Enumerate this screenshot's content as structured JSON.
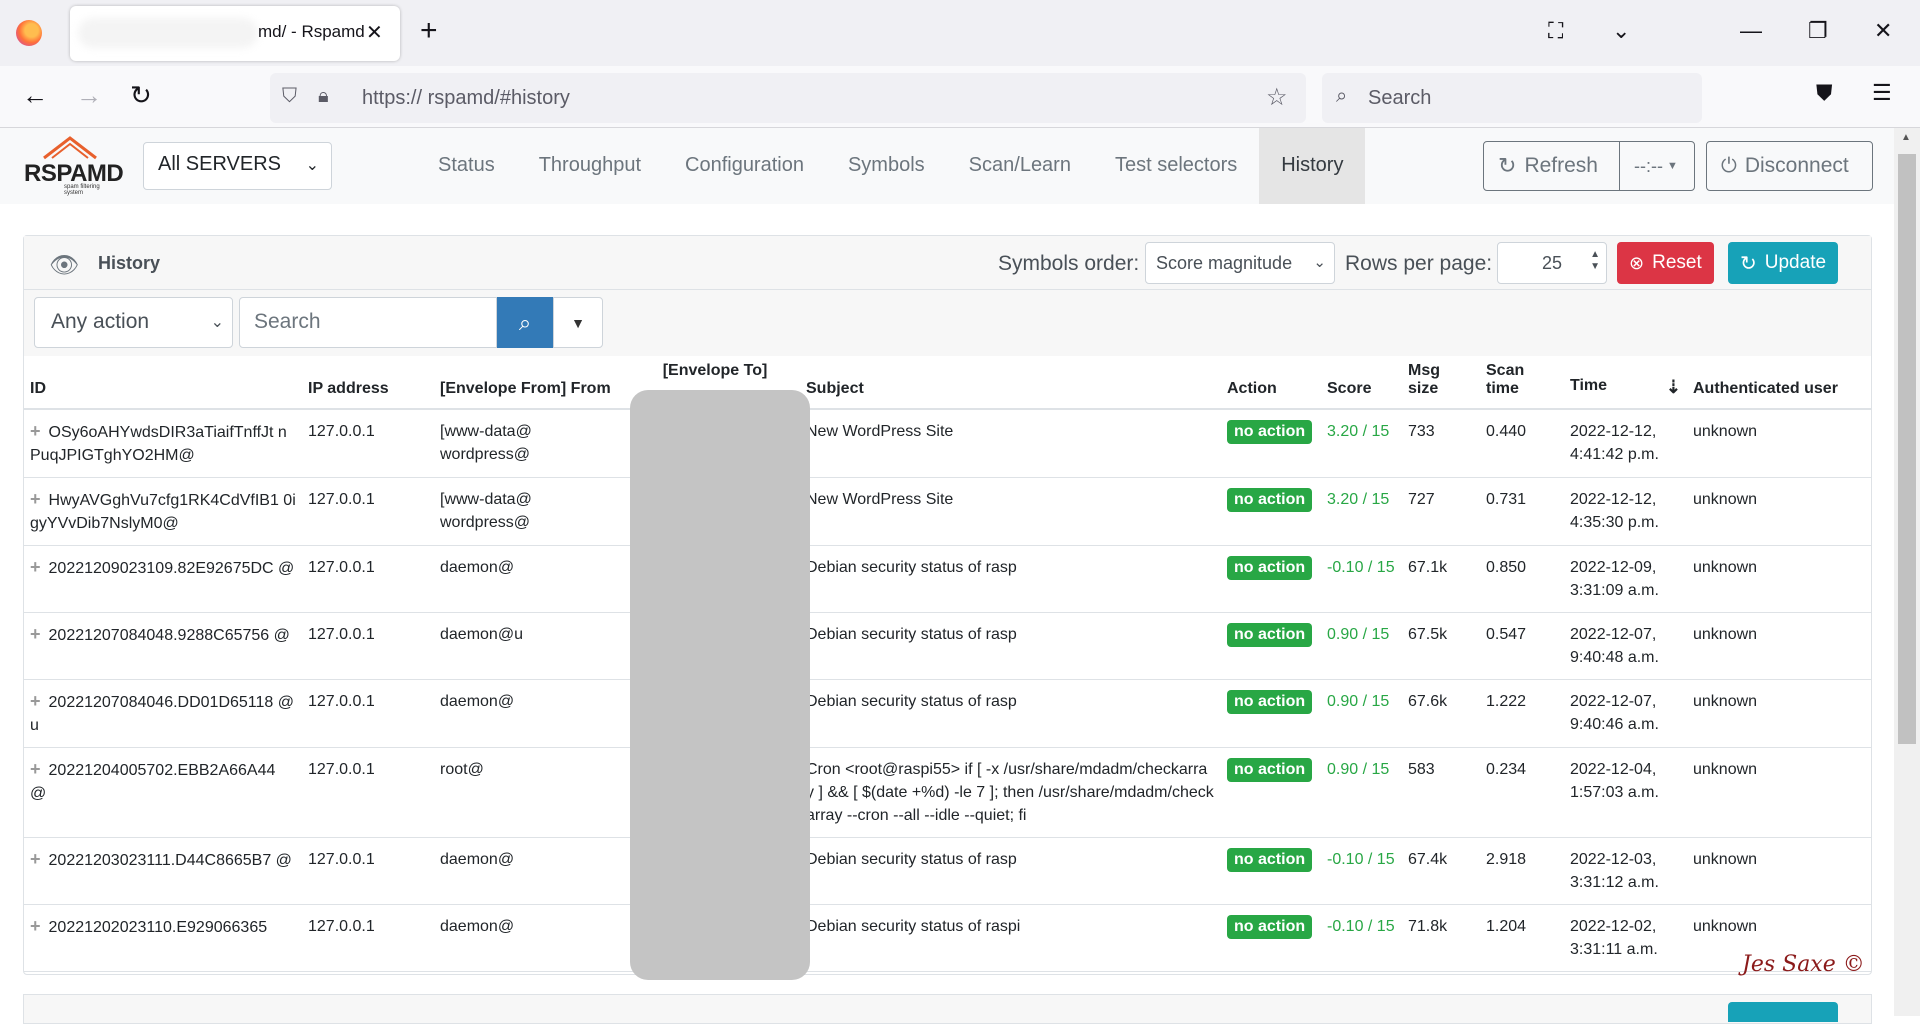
{
  "browser": {
    "tab_title": "md/ - Rspamd",
    "url": "https:// rspamd/#history",
    "search_placeholder": "Search"
  },
  "app": {
    "logo_text": "RSPAMD",
    "logo_sub": "spam filtering system",
    "server_select": "All SERVERS",
    "nav": [
      "Status",
      "Throughput",
      "Configuration",
      "Symbols",
      "Scan/Learn",
      "Test selectors",
      "History"
    ],
    "active_nav": "History",
    "refresh_label": "Refresh",
    "interval_label": "--:--",
    "disconnect_label": "Disconnect"
  },
  "history": {
    "title": "History",
    "symbols_order_label": "Symbols order:",
    "symbols_order_value": "Score magnitude",
    "rows_per_page_label": "Rows per page:",
    "rows_per_page_value": "25",
    "reset_label": "Reset",
    "update_label": "Update",
    "action_filter": "Any action",
    "search_placeholder": "Search",
    "columns": [
      "ID",
      "IP address",
      "[Envelope From] From",
      "[Envelope To]",
      "Subject",
      "Action",
      "Score",
      "Msg size",
      "Scan time",
      "Time",
      "Authenticated user"
    ],
    "rows": [
      {
        "id": "OSy6oAHYwdsDIR3aTiaifTnffJt nPuqJPIGTghYO2HM@",
        "ip": "127.0.0.1",
        "from": "[www-data@ wordpress@",
        "subject": "New WordPress Site",
        "action": "no action",
        "score": "3.20 / 15",
        "size": "733",
        "scan": "0.440",
        "time": "2022-12-12, 4:41:42 p.m.",
        "user": "unknown"
      },
      {
        "id": "HwyAVGghVu7cfg1RK4CdVfIB1 0igyYVvDib7NslyM0@",
        "ip": "127.0.0.1",
        "from": "[www-data@ wordpress@",
        "subject": "New WordPress Site",
        "action": "no action",
        "score": "3.20 / 15",
        "size": "727",
        "scan": "0.731",
        "time": "2022-12-12, 4:35:30 p.m.",
        "user": "unknown"
      },
      {
        "id": "20221209023109.82E92675DC @",
        "ip": "127.0.0.1",
        "from": "daemon@",
        "subject": "Debian security status of rasp",
        "action": "no action",
        "score": "-0.10 / 15",
        "size": "67.1k",
        "scan": "0.850",
        "time": "2022-12-09, 3:31:09 a.m.",
        "user": "unknown"
      },
      {
        "id": "20221207084048.9288C65756 @",
        "ip": "127.0.0.1",
        "from": "daemon@u",
        "subject": "Debian security status of rasp",
        "action": "no action",
        "score": "0.90 / 15",
        "size": "67.5k",
        "scan": "0.547",
        "time": "2022-12-07, 9:40:48 a.m.",
        "user": "unknown"
      },
      {
        "id": "20221207084046.DD01D65118 @u",
        "ip": "127.0.0.1",
        "from": "daemon@",
        "subject": "Debian security status of rasp",
        "action": "no action",
        "score": "0.90 / 15",
        "size": "67.6k",
        "scan": "1.222",
        "time": "2022-12-07, 9:40:46 a.m.",
        "user": "unknown"
      },
      {
        "id": "20221204005702.EBB2A66A44 @",
        "ip": "127.0.0.1",
        "from": "root@",
        "subject": "Cron <root@raspi55> if [ -x /usr/share/mdadm/checkarray ] && [ $(date +%d) -le 7 ]; then /usr/share/mdadm/checkarray --cron --all --idle --quiet; fi",
        "action": "no action",
        "score": "0.90 / 15",
        "size": "583",
        "scan": "0.234",
        "time": "2022-12-04, 1:57:03 a.m.",
        "user": "unknown"
      },
      {
        "id": "20221203023111.D44C8665B7 @",
        "ip": "127.0.0.1",
        "from": "daemon@",
        "subject": "Debian security status of rasp",
        "action": "no action",
        "score": "-0.10 / 15",
        "size": "67.4k",
        "scan": "2.918",
        "time": "2022-12-03, 3:31:12 a.m.",
        "user": "unknown"
      },
      {
        "id": "20221202023110.E929066365",
        "ip": "127.0.0.1",
        "from": "daemon@",
        "subject": "Debian security status of raspi",
        "action": "no action",
        "score": "-0.10 / 15",
        "size": "71.8k",
        "scan": "1.204",
        "time": "2022-12-02, 3:31:11 a.m.",
        "user": "unknown"
      }
    ]
  },
  "signature": "Jes Saxe ©",
  "colors": {
    "success": "#28a745",
    "danger": "#dc3545",
    "info": "#17a2b8",
    "primary": "#337ab7"
  }
}
